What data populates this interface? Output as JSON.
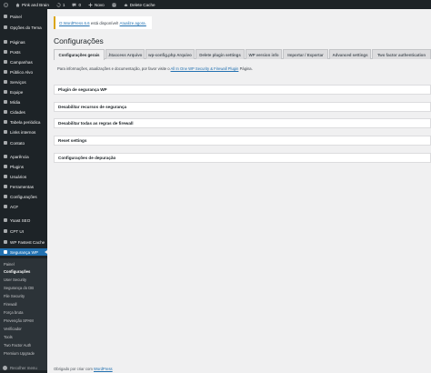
{
  "adminbar": {
    "site_name": "Pink and Brain",
    "updates_count": "1",
    "comments_count": "0",
    "new_label": "Novo",
    "delete_cache_label": "Delete Cache"
  },
  "sidebar": {
    "items": [
      {
        "label": "Painel",
        "icon": "dashboard-icon"
      },
      {
        "label": "Opções do Tema",
        "icon": "theme-options-icon"
      },
      {
        "label": "Páginas",
        "icon": "pages-icon"
      },
      {
        "label": "Posts",
        "icon": "posts-icon"
      },
      {
        "label": "Campanhas",
        "icon": "campaigns-icon"
      },
      {
        "label": "Público Alvo",
        "icon": "audience-icon"
      },
      {
        "label": "Serviços",
        "icon": "services-icon"
      },
      {
        "label": "Equipe",
        "icon": "team-icon"
      },
      {
        "label": "Mídia",
        "icon": "media-icon"
      },
      {
        "label": "Cidades",
        "icon": "cities-icon"
      },
      {
        "label": "Tabela periódica",
        "icon": "periodic-table-icon"
      },
      {
        "label": "Links internos",
        "icon": "links-icon"
      },
      {
        "label": "Contato",
        "icon": "contact-icon"
      },
      {
        "label": "Aparência",
        "icon": "appearance-icon"
      },
      {
        "label": "Plugins",
        "icon": "plugins-icon"
      },
      {
        "label": "Usuários",
        "icon": "users-icon"
      },
      {
        "label": "Ferramentas",
        "icon": "tools-icon"
      },
      {
        "label": "Configurações",
        "icon": "settings-icon"
      },
      {
        "label": "ACF",
        "icon": "acf-icon"
      },
      {
        "label": "Yoast SEO",
        "icon": "yoast-icon"
      },
      {
        "label": "CPT UI",
        "icon": "cpt-ui-icon"
      },
      {
        "label": "WP Fastest Cache",
        "icon": "cache-icon"
      },
      {
        "label": "Segurança WP",
        "icon": "shield-icon"
      }
    ],
    "submenu": [
      "Painel",
      "Configurações",
      "User Security",
      "Segurança do DB",
      "File Security",
      "Firewall",
      "Força bruta",
      "Prevenção SPAM",
      "Verificador",
      "Tools",
      "Two Factor Auth",
      "Premium Upgrade"
    ],
    "collapse_label": "Recolher menu"
  },
  "notice": {
    "link_text": "O WordPress 6.6",
    "text": " está disponível! ",
    "action_text": "Atualize agora."
  },
  "page": {
    "title": "Configurações",
    "tabs": [
      "Configurações gerais",
      ".htaccess Arquivo",
      "wp-config.php Arquivo",
      "Delete plugin settings",
      "WP version info",
      "Importar / Exportar",
      "Advanced settings",
      "Two factor authentication"
    ],
    "intro_text": "Para informações, atualizações e documentação, por favor visite o ",
    "intro_link": "All In One WP Security & Firewall Plugin",
    "intro_suffix": " Página.",
    "panels": [
      "Plugin de segurança WP",
      "Desabilitar recursos de segurança",
      "Desabilitar todas as regras de firewall",
      "Reset settings",
      "Configurações de depuração"
    ],
    "footer_text": "Obrigado por criar com ",
    "footer_link": "WordPress"
  },
  "colors": {
    "adminbar_bg": "#1d2327",
    "accent": "#2271b1",
    "notice_border": "#dba617"
  }
}
